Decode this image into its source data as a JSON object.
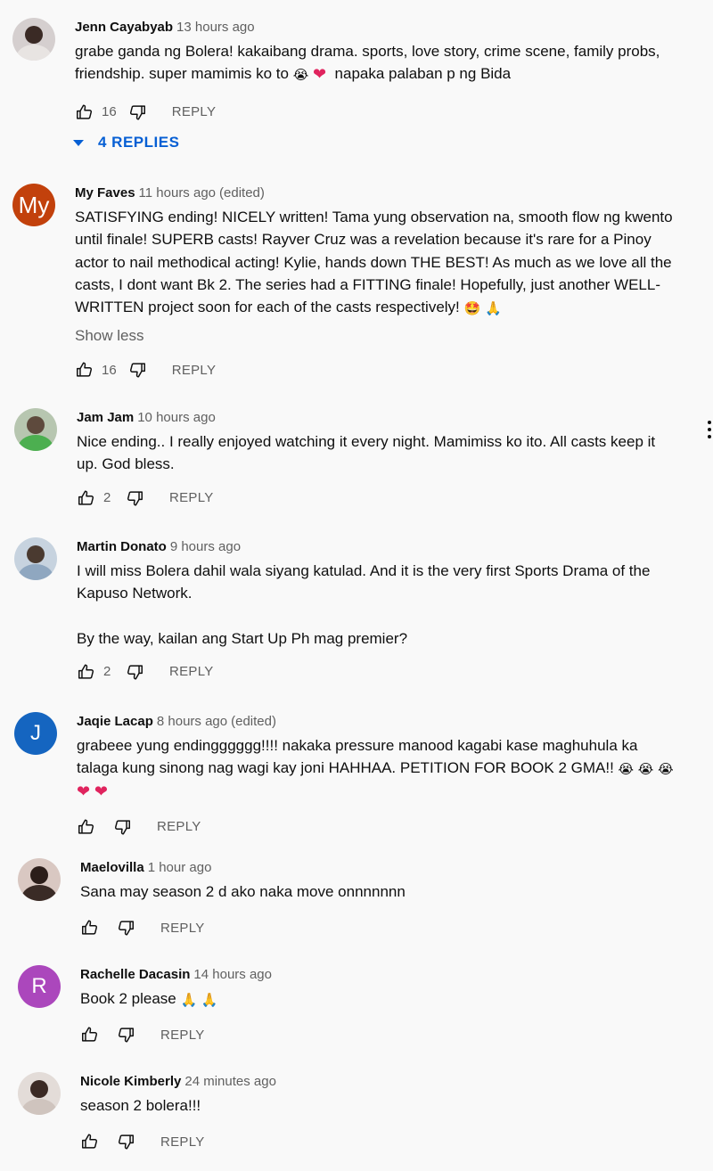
{
  "comments": [
    {
      "author": "Jenn Cayabyab",
      "time": "13 hours ago",
      "edited": "",
      "lines": [
        "grabe ganda ng Bolera! kakaibang drama. sports, love story, crime scene, family probs,",
        "friendship. super mamimis ko to"
      ],
      "line2_tail": "napaka palaban p ng Bida",
      "likes": "16",
      "reply_label": "REPLY",
      "replies_label": "4 REPLIES"
    },
    {
      "author": "My Faves",
      "time": "11 hours ago",
      "edited": "(edited)",
      "avatar_letter": "My",
      "avatar_color": "#c2410c",
      "lines": [
        "SATISFYING ending! NICELY written! Tama yung observation na, smooth flow ng kwento",
        "until finale! SUPERB casts! Rayver Cruz was a revelation because it's rare for a Pinoy",
        "actor to nail methodical acting! Kylie, hands down THE BEST! As much as we love all the",
        "casts, I dont want Bk 2. The series had a FITTING finale! Hopefully, just another WELL-",
        "WRITTEN project soon for each of the casts respectively!"
      ],
      "show_less": "Show less",
      "likes": "16",
      "reply_label": "REPLY"
    },
    {
      "author": "Jam Jam",
      "time": "10 hours ago",
      "edited": "",
      "lines": [
        "Nice ending.. I really enjoyed watching it every night. Mamimiss ko ito. All casts keep it",
        "up. God bless."
      ],
      "likes": "2",
      "reply_label": "REPLY"
    },
    {
      "author": "Martin Donato",
      "time": "9 hours ago",
      "edited": "",
      "lines": [
        "I will miss Bolera dahil wala siyang katulad. And it is the very first Sports Drama of the",
        "Kapuso Network."
      ],
      "extra_line": "By the way, kailan ang Start Up Ph mag premier?",
      "likes": "2",
      "reply_label": "REPLY"
    },
    {
      "author": "Jaqie Lacap",
      "time": "8 hours ago",
      "edited": "(edited)",
      "avatar_letter": "J",
      "avatar_color": "#1565c0",
      "lines": [
        "grabeee yung endingggggg!!!! nakaka pressure manood kagabi kase maghuhula ka",
        "talaga kung sinong nag wagi kay joni HAHHAA. PETITION FOR BOOK 2 GMA!!"
      ],
      "likes": "",
      "reply_label": "REPLY"
    },
    {
      "author": "Maelovilla",
      "time": "1 hour ago",
      "edited": "",
      "lines": [
        "Sana may season 2 d ako naka move onnnnnnn"
      ],
      "likes": "",
      "reply_label": "REPLY"
    },
    {
      "author": "Rachelle Dacasin",
      "time": "14 hours ago",
      "edited": "",
      "avatar_letter": "R",
      "avatar_color": "#ab47bc",
      "lines": [
        "Book 2 please"
      ],
      "likes": "",
      "reply_label": "REPLY"
    },
    {
      "author": "Nicole Kimberly",
      "time": "24 minutes ago",
      "edited": "",
      "lines": [
        "season 2 bolera!!!"
      ],
      "likes": "",
      "reply_label": "REPLY"
    }
  ],
  "icons": {
    "like": "thumb-up-icon",
    "dislike": "thumb-down-icon",
    "more": "more-vert-icon",
    "expand": "triangle-down-icon"
  },
  "colors": {
    "link_blue": "#065fd4",
    "meta_gray": "#606060",
    "background": "#f9f9f9"
  }
}
